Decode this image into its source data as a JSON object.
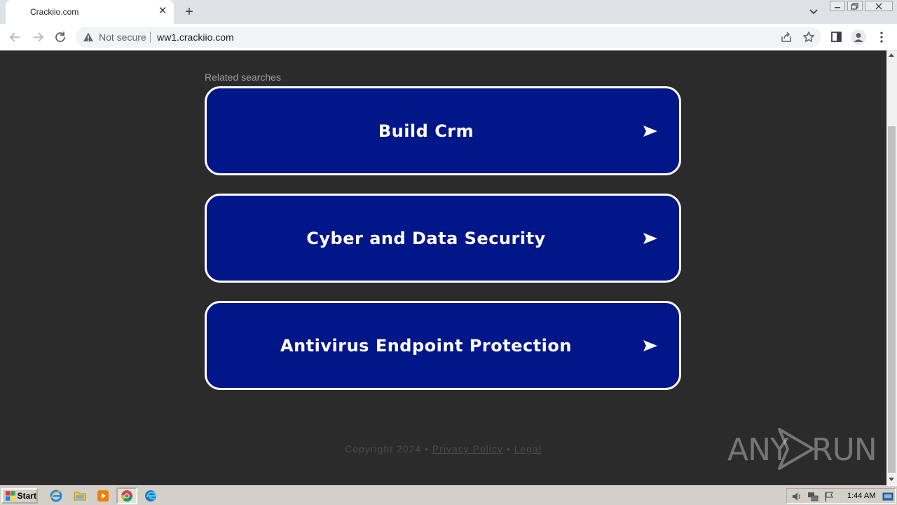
{
  "browser": {
    "tab_title": "Crackiio.com",
    "security_label": "Not secure",
    "url": "ww1.crackiio.com"
  },
  "page": {
    "section_label": "Related searches",
    "search_buttons": [
      {
        "label": "Build Crm"
      },
      {
        "label": "Cyber and Data Security"
      },
      {
        "label": "Antivirus Endpoint Protection"
      }
    ],
    "footer": {
      "copyright": "Copyright 2024",
      "separator": "•",
      "privacy_label": "Privacy Policy",
      "legal_label": "Legal"
    }
  },
  "watermark": {
    "left": "ANY",
    "right": "RUN"
  },
  "taskbar": {
    "start_label": "Start",
    "clock": "1:44 AM"
  },
  "colors": {
    "page_background": "#2b2b2b",
    "button_fill": "#011689",
    "button_border": "#ffffff"
  }
}
